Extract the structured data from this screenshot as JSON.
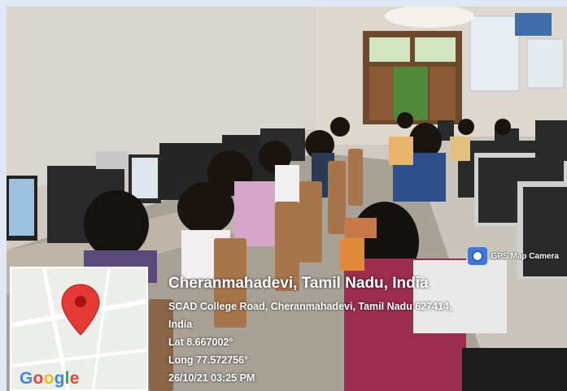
{
  "overlay": {
    "app_label": "GPS Map Camera",
    "app_icon": "camera-icon",
    "location_title": "Cheranmahadevi, Tamil Nadu, India",
    "address_line1": "SCAD College Road, Cheranmahadevi, Tamil Nadu 627414,",
    "address_line2": "India",
    "latitude": "Lat 8.667002°",
    "longitude": "Long 77.572756°",
    "datetime": "26/10/21 03:25 PM"
  },
  "map": {
    "logo_text": "Google",
    "pin_icon": "location-pin-icon",
    "pin_color": "#e53935"
  },
  "colors": {
    "frame": "#dfe9f4",
    "wall": "#d9d5cf",
    "floor": "#a69d92"
  }
}
